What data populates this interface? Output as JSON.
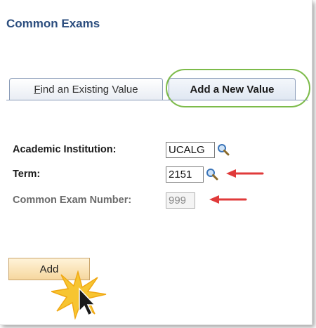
{
  "page": {
    "title": "Common Exams"
  },
  "tabs": [
    {
      "label_underlined": "F",
      "label_rest": "ind an Existing Value"
    },
    {
      "label": "Add a New Value"
    }
  ],
  "form": {
    "institution_label": "Academic Institution:",
    "institution_value": "UCALG",
    "term_label": "Term:",
    "term_value": "2151",
    "exam_number_label": "Common Exam Number:",
    "exam_number_value": "999"
  },
  "buttons": {
    "add_label": "Add"
  },
  "colors": {
    "highlight": "#7dbb4a",
    "arrow": "#e03a3a",
    "title": "#2b4d7e"
  },
  "icons": {
    "lookup": "magnifier-icon"
  }
}
